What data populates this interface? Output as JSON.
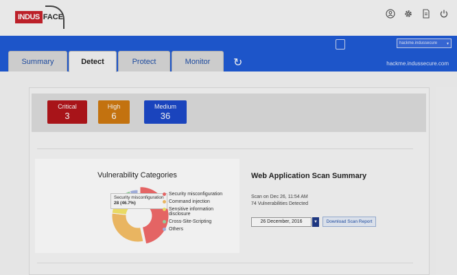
{
  "brand": {
    "box_text": "INDUS",
    "text": "FACE"
  },
  "header": {
    "site_select": "hackme.indussecure",
    "site_url": "hackme.indussecure.com"
  },
  "tabs": [
    {
      "label": "Summary"
    },
    {
      "label": "Detect"
    },
    {
      "label": "Protect"
    },
    {
      "label": "Monitor"
    }
  ],
  "severity": [
    {
      "label": "Critical",
      "count": "3",
      "color": "#b3161b"
    },
    {
      "label": "High",
      "count": "6",
      "color": "#d07a10"
    },
    {
      "label": "Medium",
      "count": "36",
      "color": "#1c49c9"
    }
  ],
  "chart_data": {
    "type": "pie",
    "title": "Vulnerability Categories",
    "labels": [
      "Security misconfiguration",
      "Command injection",
      "Sensitive information disclosure",
      "Cross-Site-Scripting",
      "Others"
    ],
    "values": [
      28,
      18,
      7,
      4,
      3
    ],
    "colors": [
      "#f36b6b",
      "#f8c168",
      "#f8e86b",
      "#9ed8a6",
      "#a9b7e6"
    ],
    "tooltip": {
      "label": "Security misconfiguration",
      "value": "28 (46.7%)"
    },
    "legend_position": "right"
  },
  "summary": {
    "title": "Web Application Scan Summary",
    "scan_date": "Scan on Dec 26, 11:54 AM",
    "detected": "74 Vulnerabilities Detected",
    "date_value": "26 December, 2016",
    "download_label": "Download Scan Report"
  },
  "icons": {
    "user": "user-icon",
    "settings": "gear-icon",
    "report": "document-icon",
    "power": "power-icon",
    "refresh": "refresh-icon"
  }
}
